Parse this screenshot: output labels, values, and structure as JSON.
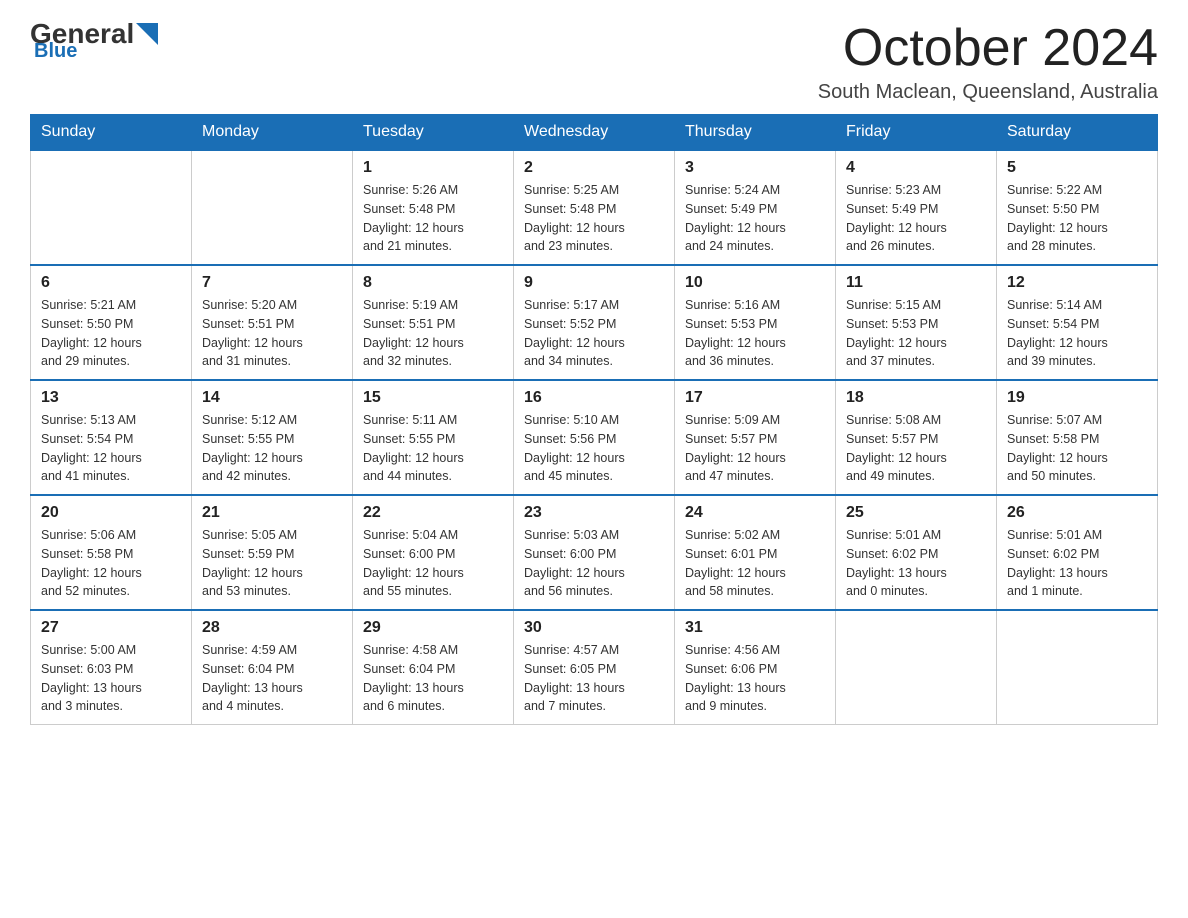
{
  "header": {
    "logo_general": "General",
    "logo_blue": "Blue",
    "title": "October 2024",
    "subtitle": "South Maclean, Queensland, Australia"
  },
  "days_of_week": [
    "Sunday",
    "Monday",
    "Tuesday",
    "Wednesday",
    "Thursday",
    "Friday",
    "Saturday"
  ],
  "weeks": [
    [
      {
        "day": "",
        "info": ""
      },
      {
        "day": "",
        "info": ""
      },
      {
        "day": "1",
        "info": "Sunrise: 5:26 AM\nSunset: 5:48 PM\nDaylight: 12 hours\nand 21 minutes."
      },
      {
        "day": "2",
        "info": "Sunrise: 5:25 AM\nSunset: 5:48 PM\nDaylight: 12 hours\nand 23 minutes."
      },
      {
        "day": "3",
        "info": "Sunrise: 5:24 AM\nSunset: 5:49 PM\nDaylight: 12 hours\nand 24 minutes."
      },
      {
        "day": "4",
        "info": "Sunrise: 5:23 AM\nSunset: 5:49 PM\nDaylight: 12 hours\nand 26 minutes."
      },
      {
        "day": "5",
        "info": "Sunrise: 5:22 AM\nSunset: 5:50 PM\nDaylight: 12 hours\nand 28 minutes."
      }
    ],
    [
      {
        "day": "6",
        "info": "Sunrise: 5:21 AM\nSunset: 5:50 PM\nDaylight: 12 hours\nand 29 minutes."
      },
      {
        "day": "7",
        "info": "Sunrise: 5:20 AM\nSunset: 5:51 PM\nDaylight: 12 hours\nand 31 minutes."
      },
      {
        "day": "8",
        "info": "Sunrise: 5:19 AM\nSunset: 5:51 PM\nDaylight: 12 hours\nand 32 minutes."
      },
      {
        "day": "9",
        "info": "Sunrise: 5:17 AM\nSunset: 5:52 PM\nDaylight: 12 hours\nand 34 minutes."
      },
      {
        "day": "10",
        "info": "Sunrise: 5:16 AM\nSunset: 5:53 PM\nDaylight: 12 hours\nand 36 minutes."
      },
      {
        "day": "11",
        "info": "Sunrise: 5:15 AM\nSunset: 5:53 PM\nDaylight: 12 hours\nand 37 minutes."
      },
      {
        "day": "12",
        "info": "Sunrise: 5:14 AM\nSunset: 5:54 PM\nDaylight: 12 hours\nand 39 minutes."
      }
    ],
    [
      {
        "day": "13",
        "info": "Sunrise: 5:13 AM\nSunset: 5:54 PM\nDaylight: 12 hours\nand 41 minutes."
      },
      {
        "day": "14",
        "info": "Sunrise: 5:12 AM\nSunset: 5:55 PM\nDaylight: 12 hours\nand 42 minutes."
      },
      {
        "day": "15",
        "info": "Sunrise: 5:11 AM\nSunset: 5:55 PM\nDaylight: 12 hours\nand 44 minutes."
      },
      {
        "day": "16",
        "info": "Sunrise: 5:10 AM\nSunset: 5:56 PM\nDaylight: 12 hours\nand 45 minutes."
      },
      {
        "day": "17",
        "info": "Sunrise: 5:09 AM\nSunset: 5:57 PM\nDaylight: 12 hours\nand 47 minutes."
      },
      {
        "day": "18",
        "info": "Sunrise: 5:08 AM\nSunset: 5:57 PM\nDaylight: 12 hours\nand 49 minutes."
      },
      {
        "day": "19",
        "info": "Sunrise: 5:07 AM\nSunset: 5:58 PM\nDaylight: 12 hours\nand 50 minutes."
      }
    ],
    [
      {
        "day": "20",
        "info": "Sunrise: 5:06 AM\nSunset: 5:58 PM\nDaylight: 12 hours\nand 52 minutes."
      },
      {
        "day": "21",
        "info": "Sunrise: 5:05 AM\nSunset: 5:59 PM\nDaylight: 12 hours\nand 53 minutes."
      },
      {
        "day": "22",
        "info": "Sunrise: 5:04 AM\nSunset: 6:00 PM\nDaylight: 12 hours\nand 55 minutes."
      },
      {
        "day": "23",
        "info": "Sunrise: 5:03 AM\nSunset: 6:00 PM\nDaylight: 12 hours\nand 56 minutes."
      },
      {
        "day": "24",
        "info": "Sunrise: 5:02 AM\nSunset: 6:01 PM\nDaylight: 12 hours\nand 58 minutes."
      },
      {
        "day": "25",
        "info": "Sunrise: 5:01 AM\nSunset: 6:02 PM\nDaylight: 13 hours\nand 0 minutes."
      },
      {
        "day": "26",
        "info": "Sunrise: 5:01 AM\nSunset: 6:02 PM\nDaylight: 13 hours\nand 1 minute."
      }
    ],
    [
      {
        "day": "27",
        "info": "Sunrise: 5:00 AM\nSunset: 6:03 PM\nDaylight: 13 hours\nand 3 minutes."
      },
      {
        "day": "28",
        "info": "Sunrise: 4:59 AM\nSunset: 6:04 PM\nDaylight: 13 hours\nand 4 minutes."
      },
      {
        "day": "29",
        "info": "Sunrise: 4:58 AM\nSunset: 6:04 PM\nDaylight: 13 hours\nand 6 minutes."
      },
      {
        "day": "30",
        "info": "Sunrise: 4:57 AM\nSunset: 6:05 PM\nDaylight: 13 hours\nand 7 minutes."
      },
      {
        "day": "31",
        "info": "Sunrise: 4:56 AM\nSunset: 6:06 PM\nDaylight: 13 hours\nand 9 minutes."
      },
      {
        "day": "",
        "info": ""
      },
      {
        "day": "",
        "info": ""
      }
    ]
  ]
}
